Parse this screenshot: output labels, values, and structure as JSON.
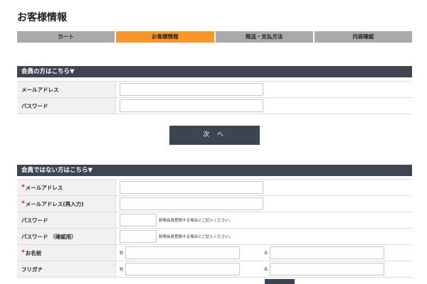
{
  "page": {
    "title": "お客様情報"
  },
  "steps": [
    {
      "label": "カート",
      "active": false
    },
    {
      "label": "お客様情報",
      "active": true
    },
    {
      "label": "発送・支払方法",
      "active": false
    },
    {
      "label": "内容確認",
      "active": false
    }
  ],
  "member_section": {
    "heading": "会員の方はこちら▼",
    "email_label": "メールアドレス",
    "password_label": "パスワード",
    "next_button": "次 へ"
  },
  "guest_section": {
    "heading": "会員ではない方はこちら▼",
    "required_mark": "*",
    "email_label": "メールアドレス",
    "email_confirm_label": "メールアドレス(再入力)",
    "password_label": "パスワード",
    "password_confirm_label": "パスワード （確認用）",
    "password_note": "新規会員登録する場合にご記入ください。",
    "password_confirm_note": "新規会員登録する場合にご記入ください。",
    "name_label": "お名前",
    "kana_label": "フリガナ",
    "last_name_prefix": "姓",
    "first_name_prefix": "名",
    "kana_last_prefix": "姓",
    "kana_first_prefix": "名"
  },
  "colors": {
    "accent": "#f7962b",
    "step_inactive": "#aaaaaa",
    "dark_bar": "#3c4550",
    "required": "#e02020"
  }
}
